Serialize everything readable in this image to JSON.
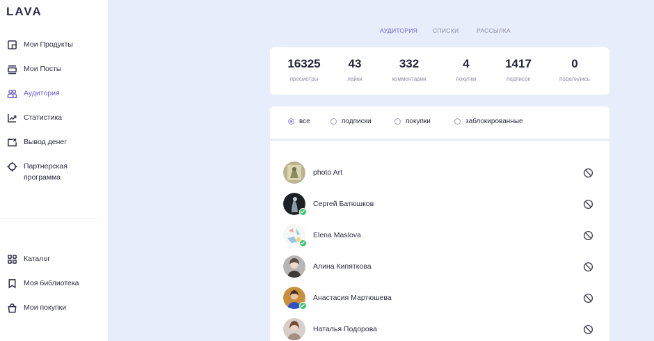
{
  "brand": {
    "logo": "LAVA"
  },
  "sidebar": {
    "top_items": [
      {
        "label": "Мои Продукты",
        "icon": "products-icon"
      },
      {
        "label": "Мои Посты",
        "icon": "posts-icon"
      },
      {
        "label": "Аудитория",
        "icon": "audience-icon",
        "active": true
      },
      {
        "label": "Статистика",
        "icon": "chart-icon"
      },
      {
        "label": "Вывод денег",
        "icon": "withdraw-icon"
      },
      {
        "label_line1": "Партнерская",
        "label_line2": "программа",
        "icon": "crosshair-icon"
      }
    ],
    "bottom_items": [
      {
        "label": "Каталог",
        "icon": "catalog-grid-icon"
      },
      {
        "label": "Моя библиотека",
        "icon": "bookmark-icon"
      },
      {
        "label": "Мои покупки",
        "icon": "shopping-bag-icon"
      }
    ]
  },
  "tabs": [
    {
      "label": "АУДИТОРИЯ",
      "active": true
    },
    {
      "label": "СПИСКИ"
    },
    {
      "label": "РАССЫЛКА"
    }
  ],
  "stats": [
    {
      "value": "16325",
      "label": "просмотры"
    },
    {
      "value": "43",
      "label": "лайки"
    },
    {
      "value": "332",
      "label": "комментарии"
    },
    {
      "value": "4",
      "label": "покупки"
    },
    {
      "value": "1417",
      "label": "подписок"
    },
    {
      "value": "0",
      "label": "поделились"
    }
  ],
  "filters": [
    {
      "label": "все",
      "checked": true
    },
    {
      "label": "подписки"
    },
    {
      "label": "покупки"
    },
    {
      "label": "заблокированные"
    }
  ],
  "users": [
    {
      "name": "photo Art",
      "verified": false
    },
    {
      "name": "Сергей Батюшков",
      "verified": true
    },
    {
      "name": "Elena Maslova",
      "verified": true
    },
    {
      "name": "Алина Кипяткова",
      "verified": false
    },
    {
      "name": "Анастасия Мартюшева",
      "verified": true
    },
    {
      "name": "Наталья Подорова",
      "verified": false
    }
  ],
  "colors": {
    "accent": "#6b5fd0",
    "background": "#e8edfb",
    "verified": "#3cc36a"
  }
}
